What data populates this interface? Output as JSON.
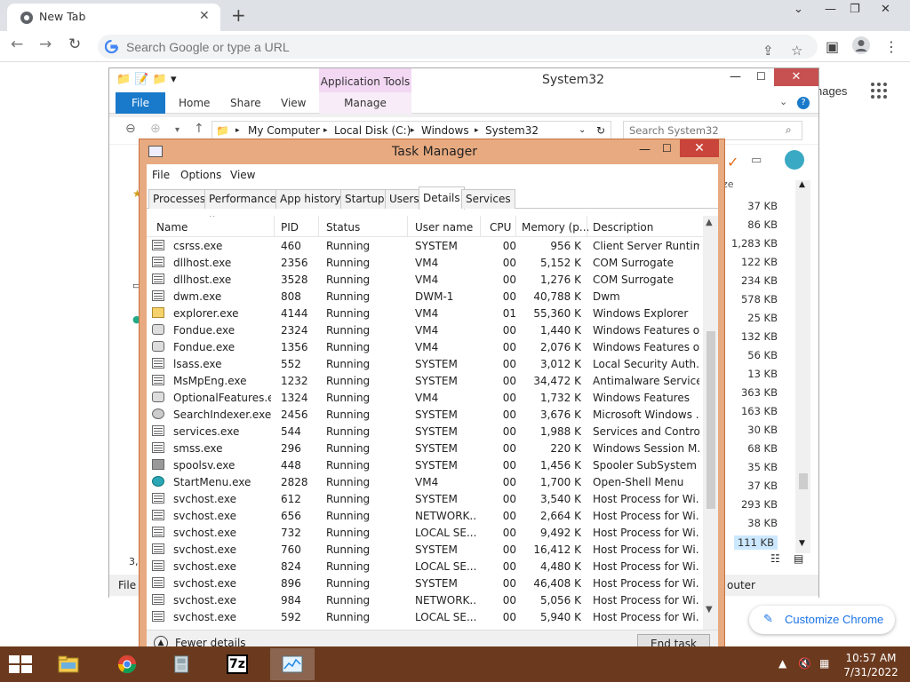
{
  "chrome": {
    "tab_title": "New Tab",
    "omnibox_placeholder": "Search Google or type a URL",
    "ntp_images_fragment": "nages",
    "customize_label": "Customize Chrome"
  },
  "explorer": {
    "title": "System32",
    "app_tools": "Application Tools",
    "ribbon_tabs": [
      "File",
      "Home",
      "Share",
      "View",
      "Manage"
    ],
    "breadcrumbs": [
      "My Computer",
      "Local Disk (C:)",
      "Windows",
      "System32"
    ],
    "search_placeholder": "Search System32",
    "size_header": "ze",
    "sizes": [
      "37 KB",
      "86 KB",
      "1,283 KB",
      "122 KB",
      "234 KB",
      "578 KB",
      "25 KB",
      "132 KB",
      "56 KB",
      "13 KB",
      "363 KB",
      "163 KB",
      "30 KB",
      "68 KB",
      "35 KB",
      "37 KB",
      "293 KB",
      "38 KB",
      "111 KB"
    ],
    "status_left": "File c",
    "status_right": "outer",
    "left_count_fragment": "3,"
  },
  "taskmgr": {
    "title": "Task Manager",
    "menu": [
      "File",
      "Options",
      "View"
    ],
    "tabs": [
      "Processes",
      "Performance",
      "App history",
      "Startup",
      "Users",
      "Details",
      "Services"
    ],
    "active_tab": "Details",
    "columns": [
      "Name",
      "PID",
      "Status",
      "User name",
      "CPU",
      "Memory (p...",
      "Description"
    ],
    "rows": [
      {
        "icon": "window",
        "name": "csrss.exe",
        "pid": "460",
        "status": "Running",
        "user": "SYSTEM",
        "cpu": "00",
        "mem": "956 K",
        "desc": "Client Server Runtim..."
      },
      {
        "icon": "window",
        "name": "dllhost.exe",
        "pid": "2356",
        "status": "Running",
        "user": "VM4",
        "cpu": "00",
        "mem": "5,152 K",
        "desc": "COM Surrogate"
      },
      {
        "icon": "window",
        "name": "dllhost.exe",
        "pid": "3528",
        "status": "Running",
        "user": "VM4",
        "cpu": "00",
        "mem": "1,276 K",
        "desc": "COM Surrogate"
      },
      {
        "icon": "window",
        "name": "dwm.exe",
        "pid": "808",
        "status": "Running",
        "user": "DWM-1",
        "cpu": "00",
        "mem": "40,788 K",
        "desc": "Dwm"
      },
      {
        "icon": "folder",
        "name": "explorer.exe",
        "pid": "4144",
        "status": "Running",
        "user": "VM4",
        "cpu": "01",
        "mem": "55,360 K",
        "desc": "Windows Explorer"
      },
      {
        "icon": "gear",
        "name": "Fondue.exe",
        "pid": "2324",
        "status": "Running",
        "user": "VM4",
        "cpu": "00",
        "mem": "1,440 K",
        "desc": "Windows Features o..."
      },
      {
        "icon": "gear",
        "name": "Fondue.exe",
        "pid": "1356",
        "status": "Running",
        "user": "VM4",
        "cpu": "00",
        "mem": "2,076 K",
        "desc": "Windows Features o..."
      },
      {
        "icon": "window",
        "name": "lsass.exe",
        "pid": "552",
        "status": "Running",
        "user": "SYSTEM",
        "cpu": "00",
        "mem": "3,012 K",
        "desc": "Local Security Auth..."
      },
      {
        "icon": "window",
        "name": "MsMpEng.exe",
        "pid": "1232",
        "status": "Running",
        "user": "SYSTEM",
        "cpu": "00",
        "mem": "34,472 K",
        "desc": "Antimalware Service..."
      },
      {
        "icon": "gear",
        "name": "OptionalFeatures.exe",
        "pid": "1324",
        "status": "Running",
        "user": "VM4",
        "cpu": "00",
        "mem": "1,732 K",
        "desc": "Windows Features"
      },
      {
        "icon": "person",
        "name": "SearchIndexer.exe",
        "pid": "2456",
        "status": "Running",
        "user": "SYSTEM",
        "cpu": "00",
        "mem": "3,676 K",
        "desc": "Microsoft Windows ..."
      },
      {
        "icon": "window",
        "name": "services.exe",
        "pid": "544",
        "status": "Running",
        "user": "SYSTEM",
        "cpu": "00",
        "mem": "1,988 K",
        "desc": "Services and Control..."
      },
      {
        "icon": "window",
        "name": "smss.exe",
        "pid": "296",
        "status": "Running",
        "user": "SYSTEM",
        "cpu": "00",
        "mem": "220 K",
        "desc": "Windows Session M..."
      },
      {
        "icon": "printer",
        "name": "spoolsv.exe",
        "pid": "448",
        "status": "Running",
        "user": "SYSTEM",
        "cpu": "00",
        "mem": "1,456 K",
        "desc": "Spooler SubSystem ..."
      },
      {
        "icon": "shell",
        "name": "StartMenu.exe",
        "pid": "2828",
        "status": "Running",
        "user": "VM4",
        "cpu": "00",
        "mem": "1,700 K",
        "desc": "Open-Shell Menu"
      },
      {
        "icon": "window",
        "name": "svchost.exe",
        "pid": "612",
        "status": "Running",
        "user": "SYSTEM",
        "cpu": "00",
        "mem": "3,540 K",
        "desc": "Host Process for Wi..."
      },
      {
        "icon": "window",
        "name": "svchost.exe",
        "pid": "656",
        "status": "Running",
        "user": "NETWORK...",
        "cpu": "00",
        "mem": "2,664 K",
        "desc": "Host Process for Wi..."
      },
      {
        "icon": "window",
        "name": "svchost.exe",
        "pid": "732",
        "status": "Running",
        "user": "LOCAL SE...",
        "cpu": "00",
        "mem": "9,492 K",
        "desc": "Host Process for Wi..."
      },
      {
        "icon": "window",
        "name": "svchost.exe",
        "pid": "760",
        "status": "Running",
        "user": "SYSTEM",
        "cpu": "00",
        "mem": "16,412 K",
        "desc": "Host Process for Wi..."
      },
      {
        "icon": "window",
        "name": "svchost.exe",
        "pid": "824",
        "status": "Running",
        "user": "LOCAL SE...",
        "cpu": "00",
        "mem": "4,480 K",
        "desc": "Host Process for Wi..."
      },
      {
        "icon": "window",
        "name": "svchost.exe",
        "pid": "896",
        "status": "Running",
        "user": "SYSTEM",
        "cpu": "00",
        "mem": "46,408 K",
        "desc": "Host Process for Wi..."
      },
      {
        "icon": "window",
        "name": "svchost.exe",
        "pid": "984",
        "status": "Running",
        "user": "NETWORK...",
        "cpu": "00",
        "mem": "5,056 K",
        "desc": "Host Process for Wi..."
      },
      {
        "icon": "window",
        "name": "svchost.exe",
        "pid": "592",
        "status": "Running",
        "user": "LOCAL SE...",
        "cpu": "00",
        "mem": "5,940 K",
        "desc": "Host Process for Wi..."
      }
    ],
    "fewer_details": "Fewer details",
    "end_task": "End task"
  },
  "taskbar": {
    "apps": [
      "file-explorer",
      "chrome",
      "archive-tool",
      "7zip",
      "task-manager"
    ],
    "active_app": "task-manager",
    "sevenzip_label": "7z",
    "time": "10:57 AM",
    "date": "7/31/2022"
  },
  "colors": {
    "taskmgr_frame": "#e8aa80",
    "taskbar": "#6b3a1e",
    "explorer_file_tab": "#1979ca",
    "app_tools": "#f3d8f4"
  }
}
